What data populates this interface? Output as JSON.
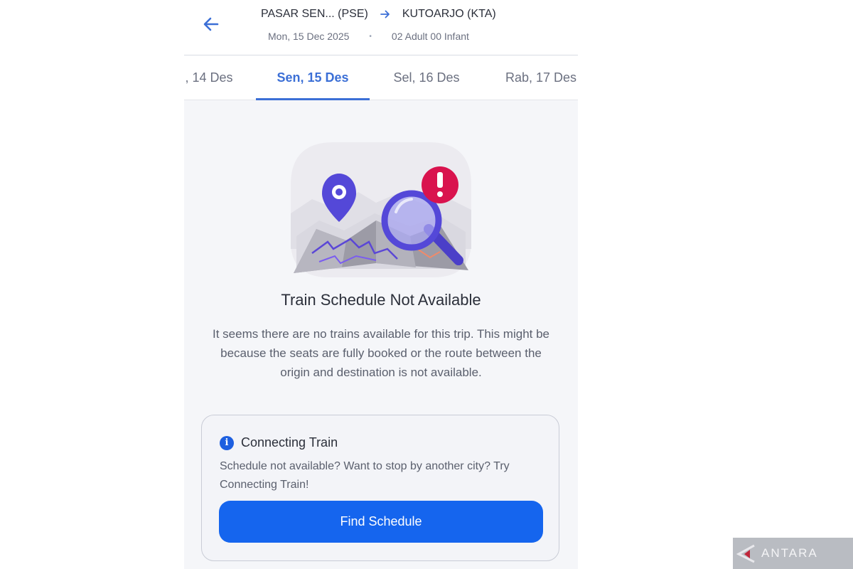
{
  "header": {
    "origin": "PASAR SEN... (PSE)",
    "destination": "KUTOARJO (KTA)",
    "date": "Mon, 15 Dec 2025",
    "separator": "•",
    "passengers": "02 Adult 00 Infant"
  },
  "tabs": [
    {
      "label": ", 14 Des",
      "active": false
    },
    {
      "label": "Sen, 15 Des",
      "active": true
    },
    {
      "label": "Sel, 16 Des",
      "active": false
    },
    {
      "label": "Rab, 17 Des",
      "active": false
    }
  ],
  "empty_state": {
    "title": "Train Schedule Not Available",
    "description": "It seems there are no trains available for this trip. This might be because the seats are fully booked or the route between the origin and destination is not available."
  },
  "connecting": {
    "title": "Connecting Train",
    "text": "Schedule not available? Want to stop by another city? Try Connecting Train!",
    "button_label": "Find Schedule"
  },
  "watermark": {
    "text": "ANTARA"
  },
  "colors": {
    "accent": "#3b6fd6",
    "button": "#1565ee",
    "alert": "#d9134e"
  },
  "icons": [
    "back-arrow-icon",
    "route-arrow-icon",
    "info-icon",
    "map-pin-icon",
    "magnifier-icon",
    "exclamation-icon"
  ]
}
